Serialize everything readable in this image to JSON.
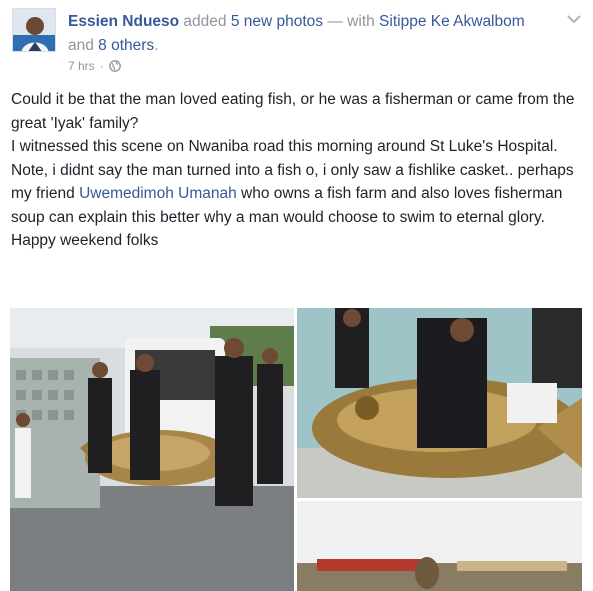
{
  "header": {
    "author": "Essien Ndueso",
    "action_prefix": " added ",
    "action_link": "5 new photos",
    "with_text": " — with ",
    "tagged_person": "Sitippe Ke Akwalbom",
    "and_text": "and ",
    "others_link": "8 others",
    "period": ".",
    "timestamp": "7 hrs",
    "separator": "·",
    "audience_icon": "globe-icon",
    "menu_icon": "chevron-down-icon"
  },
  "post": {
    "line1": "Could it be that the man loved eating fish, or he was a fisherman or came from the great 'Iyak' family?",
    "line2": "I witnessed this scene on Nwaniba road this morning around St Luke's Hospital.",
    "line3_before": "Note, i didnt say the man turned into a fish o, i only saw a fishlike casket.. perhaps my friend ",
    "mention": "Uwemedimoh Umanah",
    "line3_after": " who owns a fish farm and also loves fisherman soup can explain this better why a man would choose to swim to eternal glory.",
    "line4": "Happy weekend folks"
  },
  "colors": {
    "link": "#365899",
    "meta": "#90949c",
    "text": "#1d2129"
  }
}
